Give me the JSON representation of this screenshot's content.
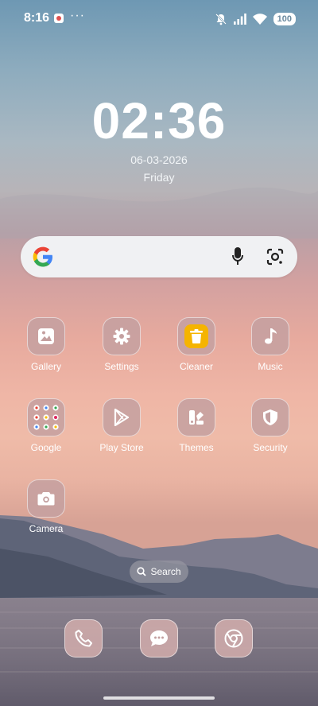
{
  "status_bar": {
    "time": "8:16",
    "more": "···",
    "battery": "100"
  },
  "clock_widget": {
    "time": "02:36",
    "date": "06-03-2026",
    "day": "Friday"
  },
  "search_widget": {
    "brand": "Google"
  },
  "apps": [
    {
      "label": "Gallery",
      "icon": "gallery-icon"
    },
    {
      "label": "Settings",
      "icon": "gear-icon"
    },
    {
      "label": "Cleaner",
      "icon": "trash-icon"
    },
    {
      "label": "Music",
      "icon": "music-note-icon"
    },
    {
      "label": "Google",
      "icon": "folder-icon"
    },
    {
      "label": "Play Store",
      "icon": "play-store-icon"
    },
    {
      "label": "Themes",
      "icon": "themes-icon"
    },
    {
      "label": "Security",
      "icon": "shield-icon"
    },
    {
      "label": "Camera",
      "icon": "camera-icon"
    }
  ],
  "app_search": {
    "label": "Search"
  },
  "dock": [
    {
      "name": "Phone",
      "icon": "phone-icon"
    },
    {
      "name": "Messages",
      "icon": "message-icon"
    },
    {
      "name": "Chrome",
      "icon": "chrome-icon"
    }
  ],
  "colors": {
    "tile": "#c4a0a0",
    "cleaner_accent": "#f5b400"
  }
}
